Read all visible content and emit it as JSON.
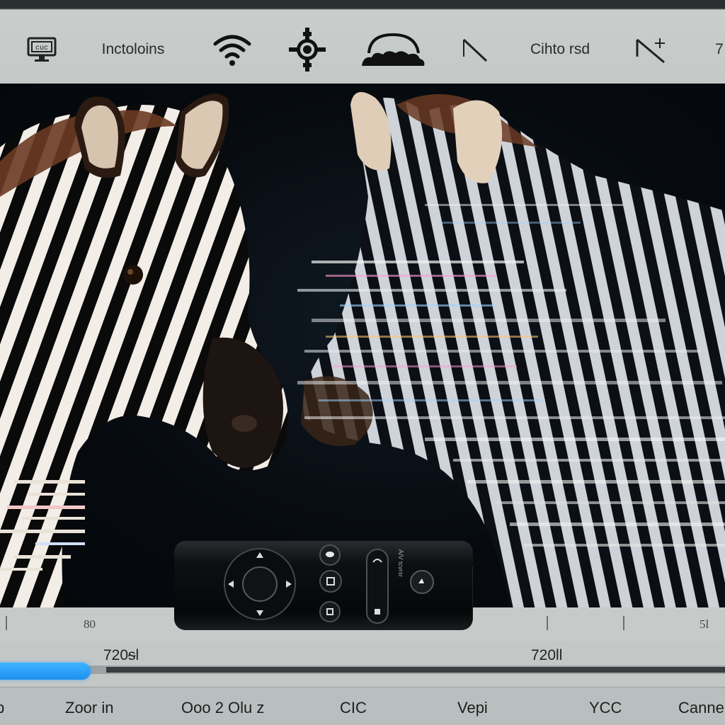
{
  "toolbar": {
    "items": [
      {
        "kind": "icon",
        "name": "monitor-icon"
      },
      {
        "kind": "text",
        "label": "Inctoloins"
      },
      {
        "kind": "icon",
        "name": "wifi-icon"
      },
      {
        "kind": "icon",
        "name": "gear-icon"
      },
      {
        "kind": "icon",
        "name": "cloud-icon"
      },
      {
        "kind": "icon",
        "name": "diagonal-line-icon"
      },
      {
        "kind": "text",
        "label": "Cihto rsd"
      },
      {
        "kind": "icon",
        "name": "line-plus-icon"
      },
      {
        "kind": "text",
        "label": "7"
      }
    ]
  },
  "viewport": {
    "subject": "zebra-original",
    "glitched_subject": "zebra-glitched"
  },
  "remote": {
    "icons": [
      "dpad-icon",
      "mic-icon",
      "home-icon",
      "back-icon",
      "power-icon",
      "menu-icon",
      "play-icon"
    ],
    "side_label": "A/V tcvrsr"
  },
  "ruler": {
    "left_label": "80",
    "right_label": "5l"
  },
  "progress": {
    "fraction": 0.125,
    "left_resolution": "720ᵴl",
    "right_resolution": "720ll"
  },
  "menu": {
    "items": [
      "p",
      "Zoor in",
      "Ooo 2 Olu z",
      "CIC",
      "Vepi",
      "YCC",
      "Canne"
    ]
  },
  "colors": {
    "accent": "#2a9cff",
    "toolbar_bg": "#c6cbca",
    "viewport_bg": "#070b10"
  }
}
